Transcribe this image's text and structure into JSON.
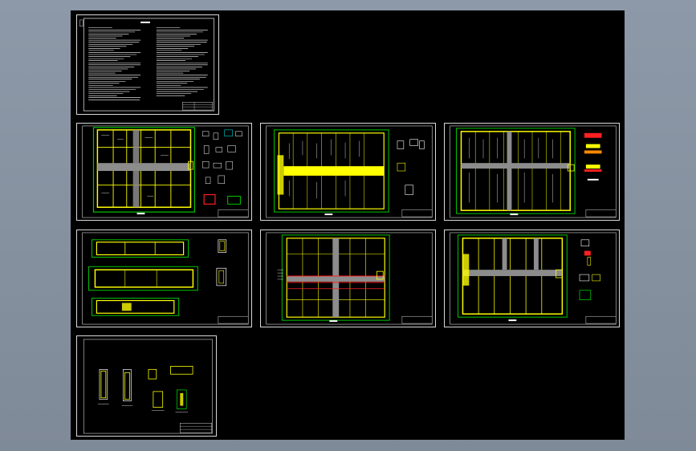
{
  "drawing": {
    "title": "",
    "sheets": [
      {
        "id": "sheet-1",
        "kind": "general-notes"
      },
      {
        "id": "sheet-2",
        "kind": "water-supply-drainage-plan"
      },
      {
        "id": "sheet-3",
        "kind": "drainage-plan"
      },
      {
        "id": "sheet-4",
        "kind": "roof-drainage-plan"
      },
      {
        "id": "sheet-5",
        "kind": "section-elevations"
      },
      {
        "id": "sheet-6",
        "kind": "pipe-plan"
      },
      {
        "id": "sheet-7",
        "kind": "plan-with-details"
      },
      {
        "id": "sheet-8",
        "kind": "detail-drawings"
      }
    ]
  },
  "colors": {
    "canvas": "#8d99a8",
    "model_space": "#000000",
    "frame": "#d8d8d8",
    "border_green": "#00c800",
    "wall_yellow": "#ffff00",
    "pipe_gray": "#8c8c8c",
    "accent_red": "#ff2020",
    "accent_cyan": "#00ffff",
    "text_white": "#ffffff"
  }
}
